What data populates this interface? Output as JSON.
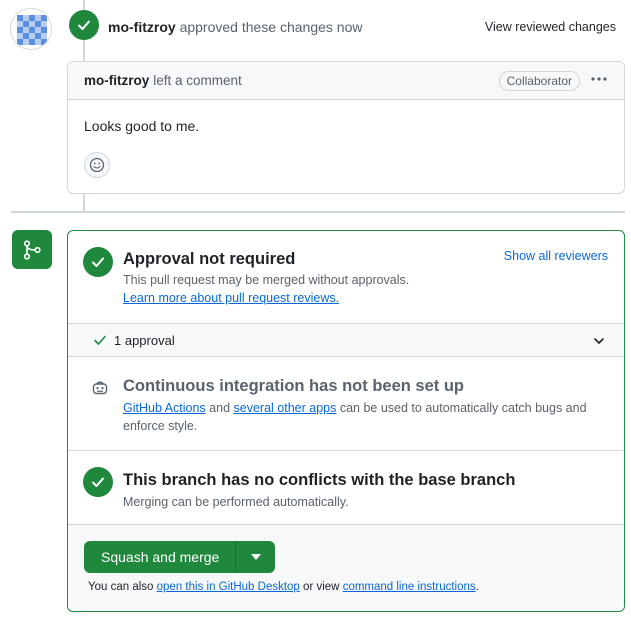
{
  "review": {
    "author": "mo-fitzroy",
    "action": "approved these changes",
    "time": "now",
    "view_changes_label": "View reviewed changes"
  },
  "comment": {
    "author": "mo-fitzroy",
    "action": "left a comment",
    "role_badge": "Collaborator",
    "body": "Looks good to me."
  },
  "merge_box": {
    "approval": {
      "title": "Approval not required",
      "description": "This pull request may be merged without approvals.",
      "learn_more_link": "Learn more about pull request reviews.",
      "show_reviewers_label": "Show all reviewers"
    },
    "approvals_row": {
      "label": "1 approval"
    },
    "ci": {
      "title": "Continuous integration has not been set up",
      "link_actions": "GitHub Actions",
      "text_and": "and",
      "link_other_apps": "several other apps",
      "text_rest": "can be used to automatically catch bugs and enforce style."
    },
    "conflicts": {
      "title": "This branch has no conflicts with the base branch",
      "description": "Merging can be performed automatically."
    },
    "merge": {
      "button_label": "Squash and merge",
      "footnote_prefix": "You can also",
      "link_desktop": "open this in GitHub Desktop",
      "footnote_middle": "or view",
      "link_cli": "command line instructions",
      "footnote_suffix": "."
    }
  },
  "colors": {
    "success": "#1f883d",
    "link": "#0969da",
    "muted_text": "#59636e",
    "border": "#d0d7de"
  },
  "icons": {
    "review_status": "check-circle-icon",
    "merge_section": "git-merge-icon",
    "ci": "robot-icon",
    "comment_reaction": "smiley-icon",
    "comment_menu": "kebab-horizontal-icon",
    "approvals_toggle": "chevron-down-icon",
    "merge_dropdown": "triangle-down-icon"
  }
}
